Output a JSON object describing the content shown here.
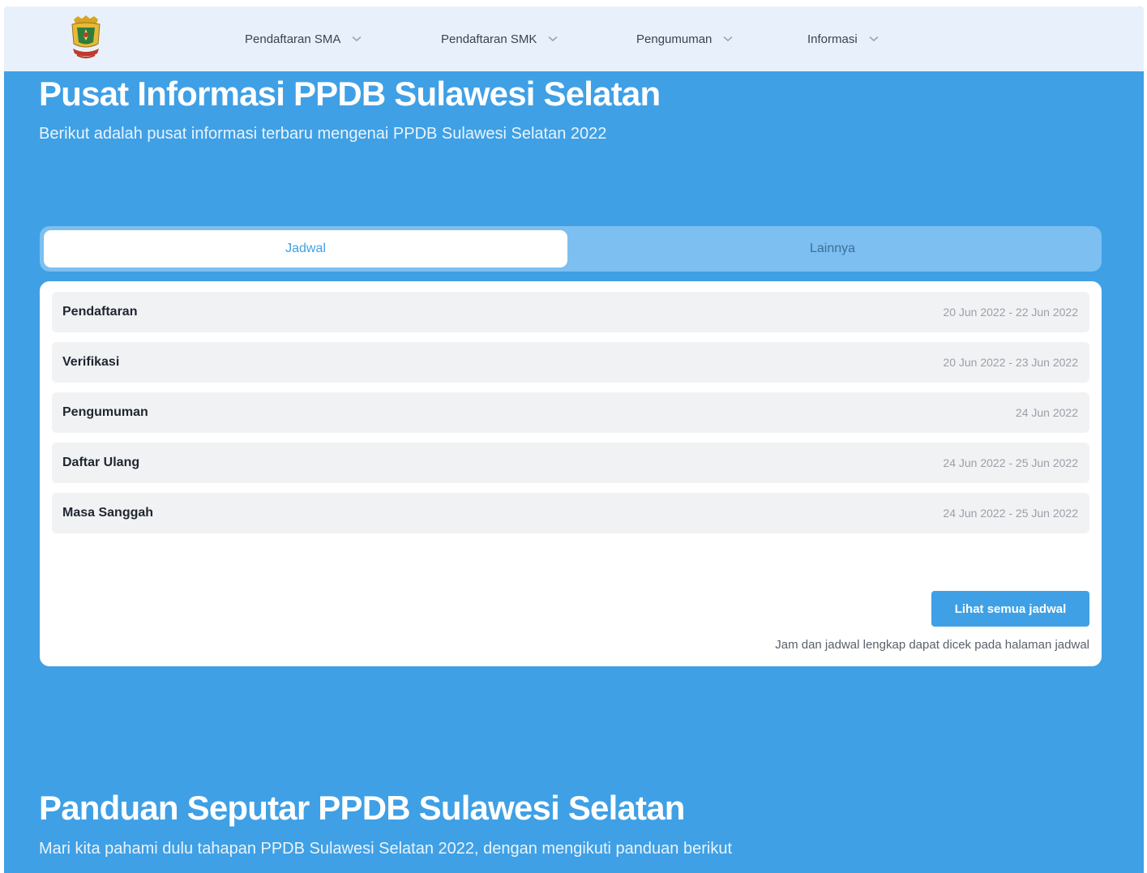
{
  "nav": {
    "items": [
      {
        "label": "Pendaftaran SMA"
      },
      {
        "label": "Pendaftaran SMK"
      },
      {
        "label": "Pengumuman"
      },
      {
        "label": "Informasi"
      }
    ]
  },
  "hero": {
    "title": "Pusat Informasi PPDB Sulawesi Selatan",
    "subtitle": "Berikut adalah pusat informasi terbaru mengenai PPDB Sulawesi Selatan 2022"
  },
  "tabs": [
    {
      "label": "Jadwal",
      "active": true
    },
    {
      "label": "Lainnya",
      "active": false
    }
  ],
  "schedule": {
    "rows": [
      {
        "label": "Pendaftaran",
        "date": "20 Jun 2022 - 22 Jun 2022"
      },
      {
        "label": "Verifikasi",
        "date": "20 Jun 2022 - 23 Jun 2022"
      },
      {
        "label": "Pengumuman",
        "date": "24 Jun 2022"
      },
      {
        "label": "Daftar Ulang",
        "date": "24 Jun 2022 - 25 Jun 2022"
      },
      {
        "label": "Masa Sanggah",
        "date": "24 Jun 2022 - 25 Jun 2022"
      }
    ],
    "button_label": "Lihat semua jadwal",
    "note": "Jam dan jadwal lengkap dapat dicek pada halaman jadwal"
  },
  "panduan": {
    "title": "Panduan Seputar PPDB Sulawesi Selatan",
    "subtitle": "Mari kita pahami dulu tahapan PPDB Sulawesi Selatan 2022, dengan mengikuti panduan berikut"
  },
  "colors": {
    "primary": "#3fa0e5",
    "navbar": "#e8f1fb",
    "tab_track": "#7cbff0",
    "row_bg": "#f1f2f4"
  },
  "icons": {
    "logo": "provincial-emblem-icon",
    "dropdown": "chevron-down-icon"
  }
}
